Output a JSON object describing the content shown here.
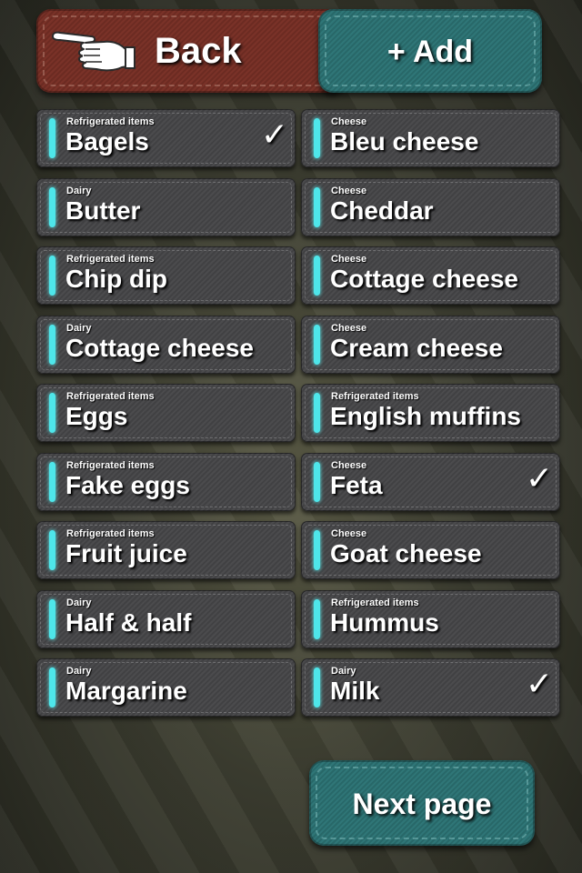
{
  "header": {
    "back_label": "Back",
    "add_label": "+ Add",
    "back_icon": "pointing-hand-icon"
  },
  "items": [
    {
      "category": "Refrigerated items",
      "name": "Bagels",
      "checked": true
    },
    {
      "category": "Cheese",
      "name": "Bleu cheese",
      "checked": false
    },
    {
      "category": "Dairy",
      "name": "Butter",
      "checked": false
    },
    {
      "category": "Cheese",
      "name": "Cheddar",
      "checked": false
    },
    {
      "category": "Refrigerated items",
      "name": "Chip dip",
      "checked": false
    },
    {
      "category": "Cheese",
      "name": "Cottage cheese",
      "checked": false
    },
    {
      "category": "Dairy",
      "name": "Cottage cheese",
      "checked": false
    },
    {
      "category": "Cheese",
      "name": "Cream cheese",
      "checked": false
    },
    {
      "category": "Refrigerated items",
      "name": "Eggs",
      "checked": false
    },
    {
      "category": "Refrigerated items",
      "name": "English muffins",
      "checked": false
    },
    {
      "category": "Refrigerated items",
      "name": "Fake eggs",
      "checked": false
    },
    {
      "category": "Cheese",
      "name": "Feta",
      "checked": true
    },
    {
      "category": "Refrigerated items",
      "name": "Fruit juice",
      "checked": false
    },
    {
      "category": "Cheese",
      "name": "Goat cheese",
      "checked": false
    },
    {
      "category": "Dairy",
      "name": "Half & half",
      "checked": false
    },
    {
      "category": "Refrigerated items",
      "name": "Hummus",
      "checked": false
    },
    {
      "category": "Dairy",
      "name": "Margarine",
      "checked": false
    },
    {
      "category": "Dairy",
      "name": "Milk",
      "checked": true
    }
  ],
  "check_glyph": "✓",
  "footer": {
    "next_label": "Next page"
  },
  "colors": {
    "back_button": "#7a3228",
    "accent_teal": "#2f7677",
    "indicator": "#4ee6ea"
  }
}
